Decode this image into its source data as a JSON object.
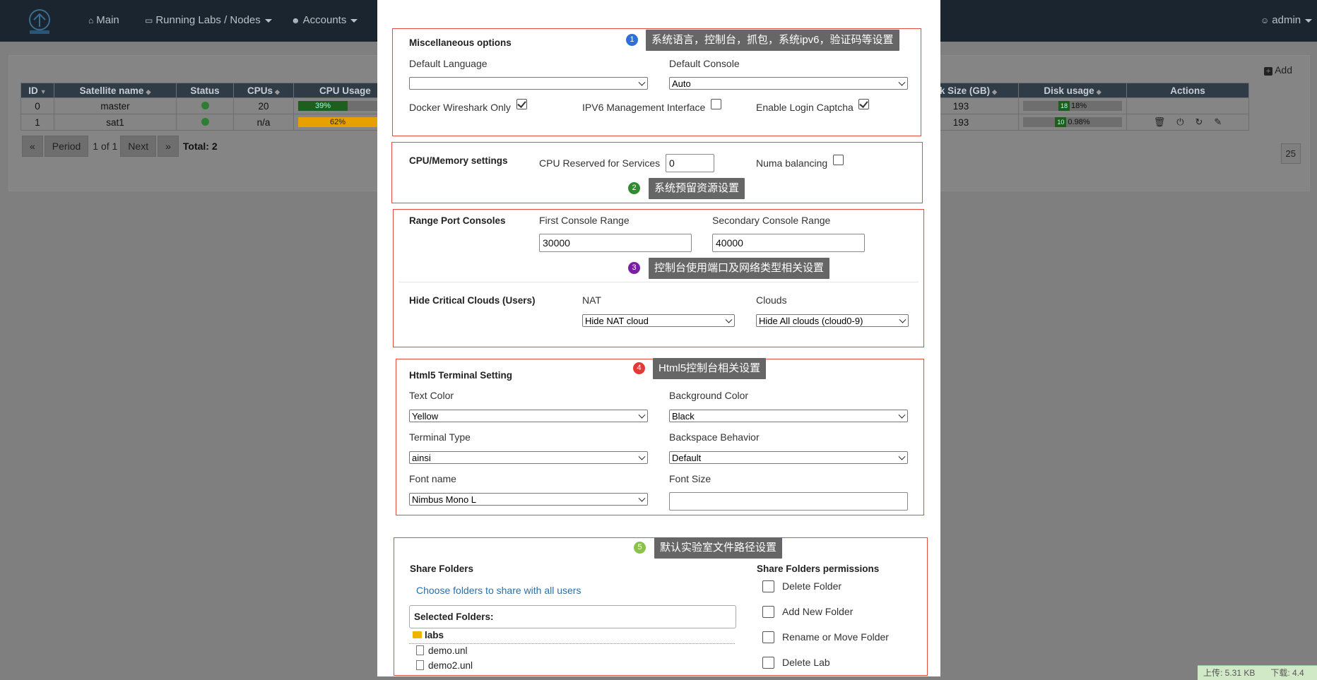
{
  "nav": {
    "main": "Main",
    "running_labs": "Running Labs / Nodes",
    "accounts": "Accounts",
    "user": "admin"
  },
  "panel": {
    "add": "Add",
    "table": {
      "headers": [
        "ID",
        "Satellite name",
        "Status",
        "CPUs",
        "CPU Usage",
        "Disk Size (GB)",
        "Disk usage",
        "Actions"
      ],
      "rows": [
        {
          "id": "0",
          "name": "master",
          "cpus": "20",
          "cpu_usage": "39%",
          "cpu_pct": 0.39,
          "disk_size": "193",
          "disk_mini": "18",
          "disk_usage": "18%"
        },
        {
          "id": "1",
          "name": "sat1",
          "cpus": "n/a",
          "cpu_usage": "62%",
          "cpu_pct": 0.62,
          "disk_size": "193",
          "disk_mini": "10",
          "disk_usage": "0.98%"
        }
      ]
    },
    "pager": {
      "period": "Period",
      "pages": "1 of 1",
      "next": "Next",
      "total": "Total: 2",
      "per_page": "25"
    }
  },
  "status_bar": {
    "upload": "上传: 5.31 KB",
    "download": "下载: 4.4"
  },
  "modal": {
    "misc": {
      "title": "Miscellaneous options",
      "default_language_label": "Default Language",
      "default_language_value": "",
      "default_console_label": "Default Console",
      "default_console_value": "Auto",
      "docker_wireshark": "Docker Wireshark Only",
      "ipv6": "IPV6 Management Interface",
      "login_captcha": "Enable Login Captcha",
      "tip_num": "1",
      "tip": "系统语言，控制台，抓包，系统ipv6，验证码等设置"
    },
    "cpu": {
      "title": "CPU/Memory settings",
      "reserved_label": "CPU Reserved for Services",
      "reserved_value": "0",
      "numa_label": "Numa balancing",
      "tip_num": "2",
      "tip": "系统预留资源设置"
    },
    "range": {
      "title": "Range Port Consoles",
      "first_label": "First Console Range",
      "first_value": "30000",
      "secondary_label": "Secondary Console Range",
      "secondary_value": "40000",
      "tip_num": "3",
      "tip": "控制台使用端口及网络类型相关设置",
      "hide_title": "Hide Critical Clouds (Users)",
      "nat_label": "NAT",
      "nat_value": "Hide NAT cloud",
      "clouds_label": "Clouds",
      "clouds_value": "Hide All clouds (cloud0-9)"
    },
    "html5": {
      "title": "Html5 Terminal Setting",
      "tip_num": "4",
      "tip": "Html5控制台相关设置",
      "text_color_label": "Text Color",
      "text_color_value": "Yellow",
      "bg_color_label": "Background Color",
      "bg_color_value": "Black",
      "terminal_type_label": "Terminal Type",
      "terminal_type_value": "ainsi",
      "backspace_label": "Backspace Behavior",
      "backspace_value": "Default",
      "font_name_label": "Font name",
      "font_name_value": "Nimbus Mono L",
      "font_size_label": "Font Size",
      "font_size_value": ""
    },
    "share": {
      "tip_num": "5",
      "tip": "默认实验室文件路径设置",
      "title": "Share Folders",
      "choose_link": "Choose folders to share with all users",
      "selected_label": "Selected Folders:",
      "folder": "labs",
      "files": [
        "demo.unl",
        "demo2.unl"
      ],
      "perm_title": "Share Folders permissions",
      "perms": [
        "Delete Folder",
        "Add New Folder",
        "Rename or Move Folder",
        "Delete Lab"
      ]
    }
  },
  "colors": {
    "accent_red": "#e74c3c",
    "tip_bg": "#666666",
    "num1": "#2f6fd8",
    "num2": "#2e8b2e",
    "num3": "#7b1fa2",
    "num4": "#e53935",
    "num5": "#8bc34a",
    "cpu_green": "#2e7d32",
    "cpu_orange": "#e6a000"
  }
}
